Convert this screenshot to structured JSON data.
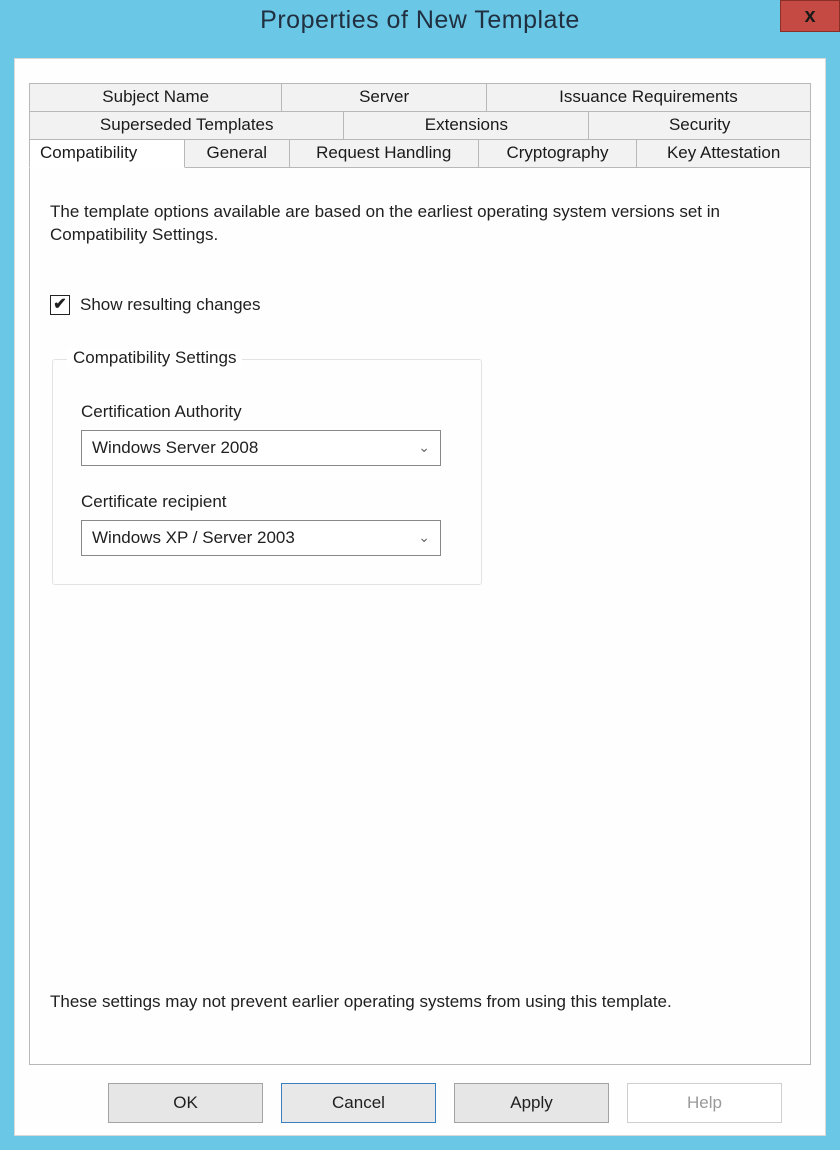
{
  "window": {
    "title": "Properties of New Template",
    "close_icon": "x"
  },
  "tabs": {
    "row1": [
      "Subject Name",
      "Server",
      "Issuance Requirements"
    ],
    "row2": [
      "Superseded Templates",
      "Extensions",
      "Security"
    ],
    "row3": [
      "Compatibility",
      "General",
      "Request Handling",
      "Cryptography",
      "Key Attestation"
    ],
    "active": "Compatibility"
  },
  "panel": {
    "intro": "The template options available are based on the earliest operating system versions set in Compatibility Settings.",
    "show_changes_label": "Show resulting changes",
    "show_changes_checked": true,
    "group_title": "Compatibility Settings",
    "ca_label": "Certification Authority",
    "ca_value": "Windows Server 2008",
    "recipient_label": "Certificate recipient",
    "recipient_value": "Windows XP / Server 2003",
    "footnote": "These settings may not prevent earlier operating systems from using this template."
  },
  "buttons": {
    "ok": "OK",
    "cancel": "Cancel",
    "apply": "Apply",
    "help": "Help"
  }
}
